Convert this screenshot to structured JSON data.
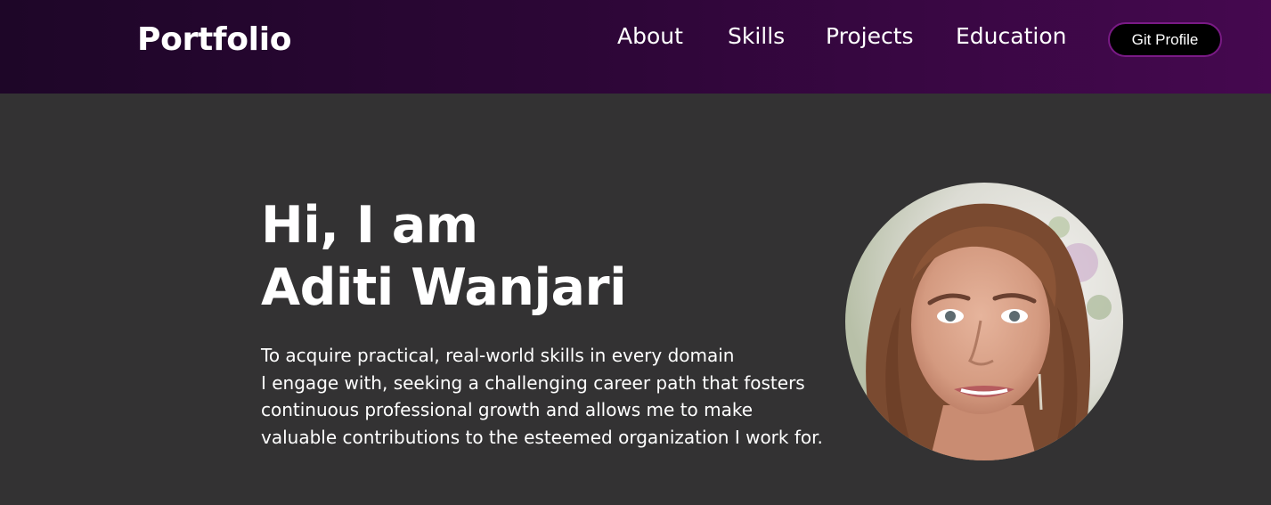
{
  "nav": {
    "logo": "Portfolio",
    "links": [
      {
        "label": "About"
      },
      {
        "label": "Skills"
      },
      {
        "label": "Projects"
      },
      {
        "label": "Education"
      }
    ],
    "git_button": "Git Profile"
  },
  "hero": {
    "greeting": "Hi, I am",
    "name": "Aditi Wanjari",
    "description_lines": [
      "To acquire practical, real-world skills in every domain",
      "I engage with, seeking a challenging career path that fosters",
      "continuous professional growth and allows me to make",
      "valuable contributions to the esteemed organization I work for."
    ]
  },
  "colors": {
    "page_background": "#333233",
    "navbar_gradient_start": "#1e0628",
    "navbar_gradient_end": "#45084f",
    "button_border": "#7a1a86",
    "text": "#ffffff"
  }
}
